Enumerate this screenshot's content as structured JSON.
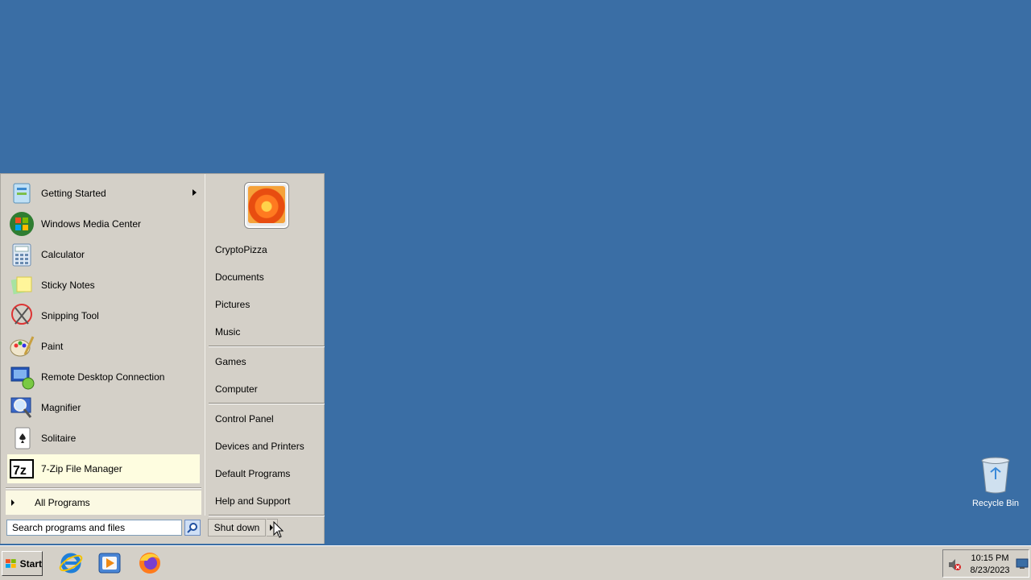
{
  "start_menu": {
    "programs": [
      {
        "label": "Getting Started",
        "icon": "getting-started-icon",
        "has_submenu": true
      },
      {
        "label": "Windows Media Center",
        "icon": "windows-media-center-icon"
      },
      {
        "label": "Calculator",
        "icon": "calculator-icon"
      },
      {
        "label": "Sticky Notes",
        "icon": "sticky-notes-icon"
      },
      {
        "label": "Snipping Tool",
        "icon": "snipping-tool-icon"
      },
      {
        "label": "Paint",
        "icon": "paint-icon"
      },
      {
        "label": "Remote Desktop Connection",
        "icon": "remote-desktop-icon"
      },
      {
        "label": "Magnifier",
        "icon": "magnifier-icon"
      },
      {
        "label": "Solitaire",
        "icon": "solitaire-icon"
      },
      {
        "label": "7-Zip File Manager",
        "icon": "7zip-icon"
      }
    ],
    "all_programs": "All Programs",
    "search_placeholder": "Search programs and files",
    "right_items": {
      "user": "CryptoPizza",
      "documents": "Documents",
      "pictures": "Pictures",
      "music": "Music",
      "games": "Games",
      "computer": "Computer",
      "control_panel": "Control Panel",
      "devices": "Devices and Printers",
      "default_programs": "Default Programs",
      "help": "Help and Support"
    },
    "shutdown_label": "Shut down"
  },
  "taskbar": {
    "start_label": "Start",
    "pinned": [
      "internet-explorer-icon",
      "media-player-icon",
      "firefox-icon"
    ],
    "clock_time": "10:15 PM",
    "clock_date": "8/23/2023"
  },
  "desktop": {
    "recycle_bin_label": "Recycle Bin"
  },
  "colors": {
    "desktop": "#3a6ea5",
    "menu_bg": "#d4d0c8",
    "highlight": "#fefde0"
  }
}
